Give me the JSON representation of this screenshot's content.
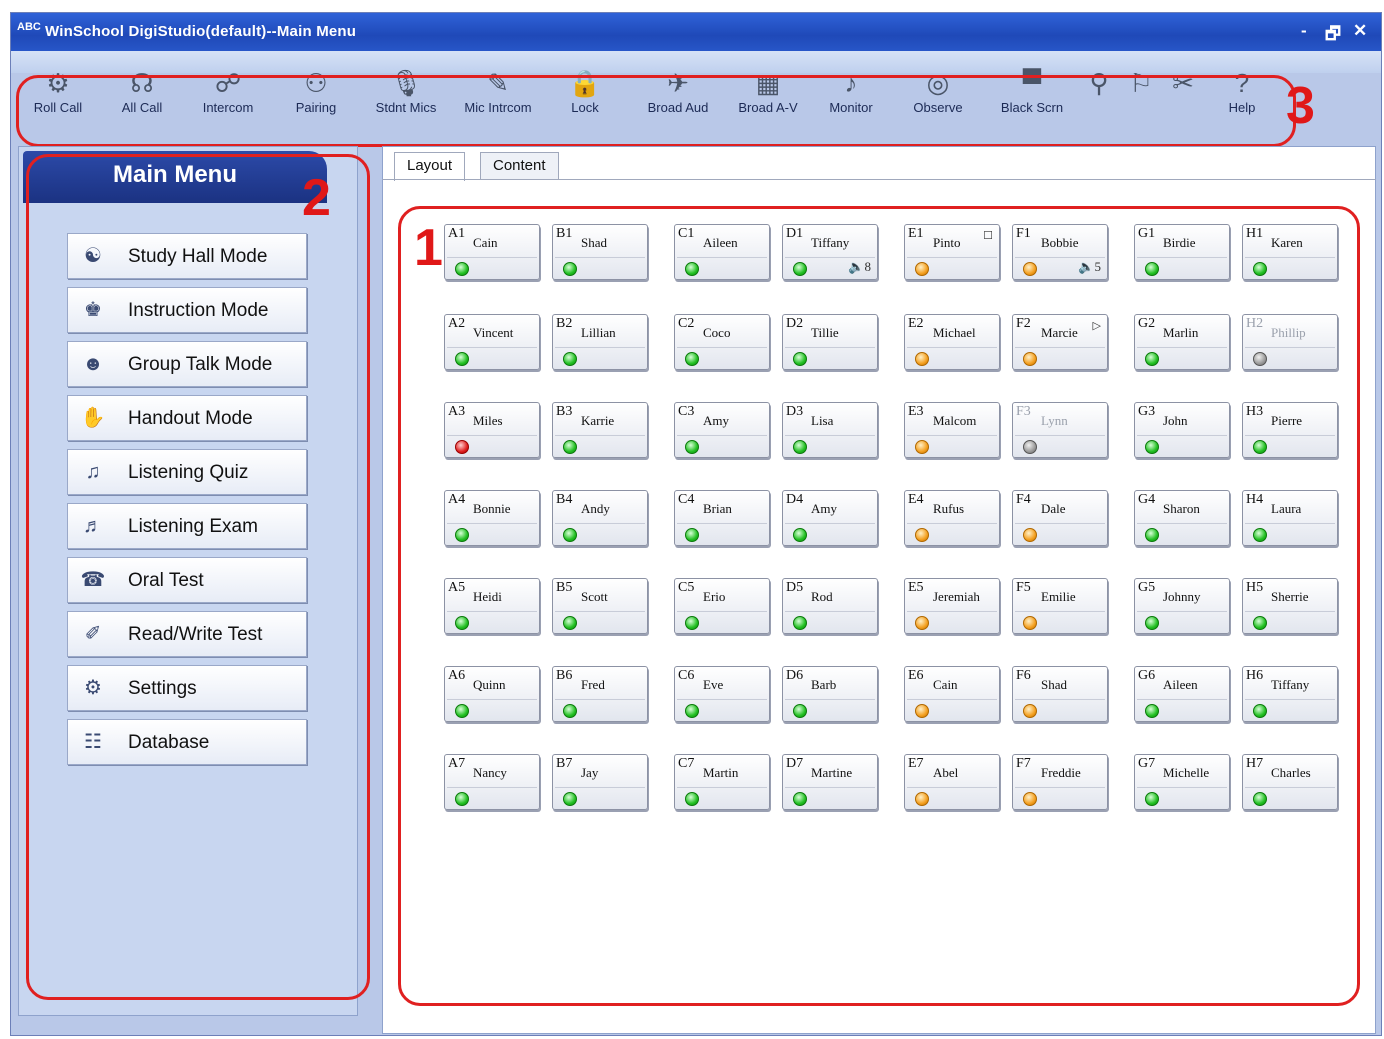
{
  "window": {
    "title": "WinSchool DigiStudio(default)--Main Menu",
    "icon_text": "ABC",
    "controls": {
      "minimize": "-",
      "restore": "🗗",
      "close": "✕"
    }
  },
  "toolbar": {
    "items": [
      {
        "id": "roll-call",
        "label": "Roll Call",
        "icon": "⚙"
      },
      {
        "id": "all-call",
        "label": "All Call",
        "icon": "☊"
      },
      {
        "id": "intercom",
        "label": "Intercom",
        "icon": "☍"
      },
      {
        "id": "pairing",
        "label": "Pairing",
        "icon": "⚇"
      },
      {
        "id": "stdnt-mics",
        "label": "Stdnt Mics",
        "icon": "🎙"
      },
      {
        "id": "mic-intrcom",
        "label": "Mic Intrcom",
        "icon": "✎"
      },
      {
        "id": "lock",
        "label": "Lock",
        "icon": "🔒"
      },
      {
        "id": "broad-aud",
        "label": "Broad Aud",
        "icon": "✈"
      },
      {
        "id": "broad-a-v",
        "label": "Broad A-V",
        "icon": "▦"
      },
      {
        "id": "monitor",
        "label": "Monitor",
        "icon": "♪"
      },
      {
        "id": "observe",
        "label": "Observe",
        "icon": "◎"
      },
      {
        "id": "black-scrn",
        "label": "Black Scrn",
        "icon": "▀"
      },
      {
        "id": "tool-a",
        "label": "",
        "icon": "⚲"
      },
      {
        "id": "tool-b",
        "label": "",
        "icon": "⚐"
      },
      {
        "id": "tool-c",
        "label": "",
        "icon": "✂"
      },
      {
        "id": "help",
        "label": "Help",
        "icon": "?"
      }
    ]
  },
  "annotations": {
    "one": "1",
    "two": "2",
    "three": "3"
  },
  "main_menu": {
    "title": "Main Menu",
    "items": [
      {
        "label": "Study Hall Mode",
        "icon": "☯"
      },
      {
        "label": "Instruction Mode",
        "icon": "♚"
      },
      {
        "label": "Group Talk Mode",
        "icon": "☻"
      },
      {
        "label": "Handout Mode",
        "icon": "✋"
      },
      {
        "label": "Listening Quiz",
        "icon": "♫"
      },
      {
        "label": "Listening Exam",
        "icon": "♬"
      },
      {
        "label": "Oral Test",
        "icon": "☎"
      },
      {
        "label": "Read/Write Test",
        "icon": "✐"
      },
      {
        "label": "Settings",
        "icon": "⚙"
      },
      {
        "label": "Database",
        "icon": "☷"
      }
    ]
  },
  "tabs": [
    {
      "label": "Layout"
    },
    {
      "label": "Content"
    }
  ],
  "seats": [
    [
      {
        "code": "A1",
        "name": "Cain",
        "status": "green"
      },
      {
        "code": "B1",
        "name": "Shad",
        "status": "green"
      },
      {
        "code": "C1",
        "name": "Aileen",
        "status": "green"
      },
      {
        "code": "D1",
        "name": "Tiffany",
        "status": "green",
        "extra": "🔈8"
      },
      {
        "code": "E1",
        "name": "Pinto",
        "status": "orange",
        "corner": "☐"
      },
      {
        "code": "F1",
        "name": "Bobbie",
        "status": "orange",
        "extra": "🔈5"
      },
      {
        "code": "G1",
        "name": "Birdie",
        "status": "green"
      },
      {
        "code": "H1",
        "name": "Karen",
        "status": "green"
      }
    ],
    [
      {
        "code": "A2",
        "name": "Vincent",
        "status": "green"
      },
      {
        "code": "B2",
        "name": "Lillian",
        "status": "green"
      },
      {
        "code": "C2",
        "name": "Coco",
        "status": "green"
      },
      {
        "code": "D2",
        "name": "Tillie",
        "status": "green"
      },
      {
        "code": "E2",
        "name": "Michael",
        "status": "orange"
      },
      {
        "code": "F2",
        "name": "Marcie",
        "status": "orange",
        "corner": "▷"
      },
      {
        "code": "G2",
        "name": "Marlin",
        "status": "green"
      },
      {
        "code": "H2",
        "name": "Phillip",
        "status": "gray",
        "disabled": true
      }
    ],
    [
      {
        "code": "A3",
        "name": "Miles",
        "status": "red"
      },
      {
        "code": "B3",
        "name": "Karrie",
        "status": "green"
      },
      {
        "code": "C3",
        "name": "Amy",
        "status": "green"
      },
      {
        "code": "D3",
        "name": "Lisa",
        "status": "green"
      },
      {
        "code": "E3",
        "name": "Malcom",
        "status": "orange"
      },
      {
        "code": "F3",
        "name": "Lynn",
        "status": "gray",
        "disabled": true
      },
      {
        "code": "G3",
        "name": "John",
        "status": "green"
      },
      {
        "code": "H3",
        "name": "Pierre",
        "status": "green"
      }
    ],
    [
      {
        "code": "A4",
        "name": "Bonnie",
        "status": "green"
      },
      {
        "code": "B4",
        "name": "Andy",
        "status": "green"
      },
      {
        "code": "C4",
        "name": "Brian",
        "status": "green"
      },
      {
        "code": "D4",
        "name": "Amy",
        "status": "green"
      },
      {
        "code": "E4",
        "name": "Rufus",
        "status": "orange"
      },
      {
        "code": "F4",
        "name": "Dale",
        "status": "orange"
      },
      {
        "code": "G4",
        "name": "Sharon",
        "status": "green"
      },
      {
        "code": "H4",
        "name": "Laura",
        "status": "green"
      }
    ],
    [
      {
        "code": "A5",
        "name": "Heidi",
        "status": "green"
      },
      {
        "code": "B5",
        "name": "Scott",
        "status": "green"
      },
      {
        "code": "C5",
        "name": "Erio",
        "status": "green"
      },
      {
        "code": "D5",
        "name": "Rod",
        "status": "green"
      },
      {
        "code": "E5",
        "name": "Jeremiah",
        "status": "orange"
      },
      {
        "code": "F5",
        "name": "Emilie",
        "status": "orange"
      },
      {
        "code": "G5",
        "name": "Johnny",
        "status": "green"
      },
      {
        "code": "H5",
        "name": "Sherrie",
        "status": "green"
      }
    ],
    [
      {
        "code": "A6",
        "name": "Quinn",
        "status": "green"
      },
      {
        "code": "B6",
        "name": "Fred",
        "status": "green"
      },
      {
        "code": "C6",
        "name": "Eve",
        "status": "green"
      },
      {
        "code": "D6",
        "name": "Barb",
        "status": "green"
      },
      {
        "code": "E6",
        "name": "Cain",
        "status": "orange"
      },
      {
        "code": "F6",
        "name": "Shad",
        "status": "orange"
      },
      {
        "code": "G6",
        "name": "Aileen",
        "status": "green"
      },
      {
        "code": "H6",
        "name": "Tiffany",
        "status": "green"
      }
    ],
    [
      {
        "code": "A7",
        "name": "Nancy",
        "status": "green"
      },
      {
        "code": "B7",
        "name": "Jay",
        "status": "green"
      },
      {
        "code": "C7",
        "name": "Martin",
        "status": "green"
      },
      {
        "code": "D7",
        "name": "Martine",
        "status": "green"
      },
      {
        "code": "E7",
        "name": "Abel",
        "status": "orange"
      },
      {
        "code": "F7",
        "name": "Freddie",
        "status": "orange"
      },
      {
        "code": "G7",
        "name": "Michelle",
        "status": "green"
      },
      {
        "code": "H7",
        "name": "Charles",
        "status": "green"
      }
    ]
  ]
}
